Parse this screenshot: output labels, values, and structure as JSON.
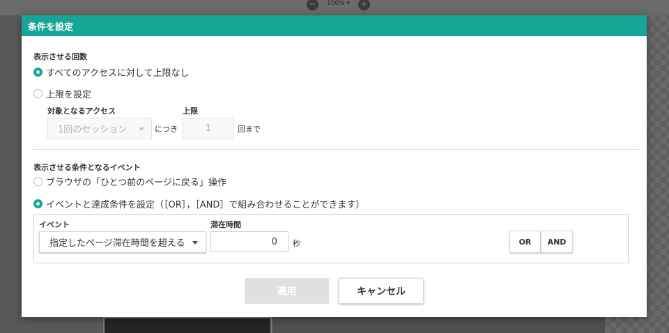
{
  "toolbar": {
    "zoom_out_glyph": "−",
    "zoom_level": "100% ▾",
    "zoom_in_glyph": "+"
  },
  "dialog": {
    "title": "条件を設定",
    "display_count": {
      "title": "表示させる回数",
      "option_unlimited": "すべてのアクセスに対して上限なし",
      "option_limit": "上限を設定",
      "selected": "option_unlimited",
      "target_access_label": "対象となるアクセス",
      "target_access_value": "1回のセッション",
      "per_label": "につき",
      "limit_label": "上限",
      "limit_value": "1",
      "times_suffix": "回まで"
    },
    "event_condition": {
      "title": "表示させる条件となるイベント",
      "option_browser_back": "ブラウザの「ひとつ前のページに戻る」操作",
      "option_event": "イベントと達成条件を設定（［OR］，［AND］で組み合わせることができます）",
      "selected": "option_event",
      "event_label": "イベント",
      "event_value": "指定したページ滞在時間を超える",
      "dwell_label": "滞在時間",
      "dwell_value": "0",
      "dwell_unit": "秒",
      "or_button": "OR",
      "and_button": "AND"
    },
    "apply_button": "適用",
    "cancel_button": "キャンセル"
  },
  "colors": {
    "accent": "#16a596",
    "overlay": "#585858",
    "disabled_button": "#e0e0e0"
  },
  "icons": {
    "zoom_out": "minus-circle-icon",
    "zoom_in": "plus-circle-icon",
    "dropdown": "caret-down-icon"
  }
}
